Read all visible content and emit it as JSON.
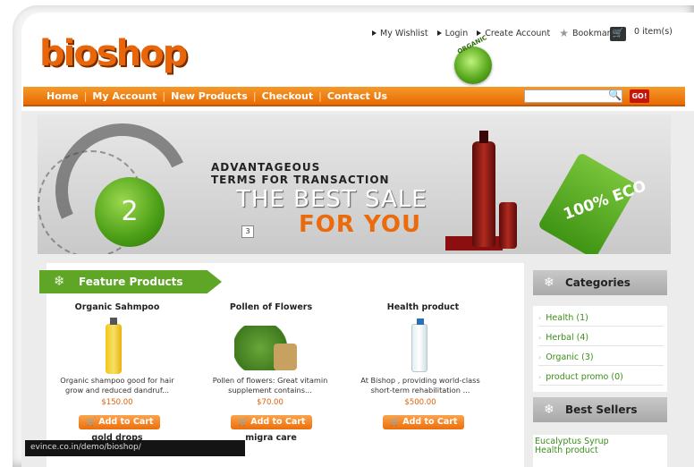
{
  "header": {
    "logo": "bioshop",
    "organic_badge": "ORGANIC",
    "top_links": [
      "My Wishlist",
      "Login",
      "Create Account",
      "Bookmark"
    ],
    "cart": "0 item(s)"
  },
  "nav": {
    "items": [
      "Home",
      "My Account",
      "New Products",
      "Checkout",
      "Contact Us"
    ],
    "search": {
      "value": "",
      "go": "GO!"
    }
  },
  "banner": {
    "slide": "2",
    "line1": "ADVANTAGEOUS",
    "line2": "TERMS FOR TRANSACTION",
    "line3": "THE BEST SALE",
    "line4": "FOR YOU",
    "pager": "3",
    "eco_tag": "100% ECO"
  },
  "feature": {
    "title": "Feature Products",
    "products": [
      {
        "name": "Organic Sahmpoo",
        "desc": "Organic shampoo good for hair grow and reduced dandruf...",
        "price": "$150.00",
        "button": "Add to Cart",
        "next": "gold drops"
      },
      {
        "name": "Pollen of Flowers",
        "desc": "Pollen of flowers: Great vitamin supplement contains...",
        "price": "$70.00",
        "button": "Add to Cart",
        "next": "migra care"
      },
      {
        "name": "Health product",
        "desc": "At Bishop , providing world-class short-term rehabilitation ...",
        "price": "$500.00",
        "button": "Add to Cart",
        "next": ""
      }
    ]
  },
  "sidebar": {
    "categories_title": "Categories",
    "categories": [
      "Health (1)",
      "Herbal (4)",
      "Organic (3)",
      "product promo (0)"
    ],
    "best_sellers_title": "Best Sellers",
    "best_sellers": [
      "Eucalyptus Syrup",
      "Health product"
    ]
  },
  "status_url": "evince.co.in/demo/bioshop/"
}
